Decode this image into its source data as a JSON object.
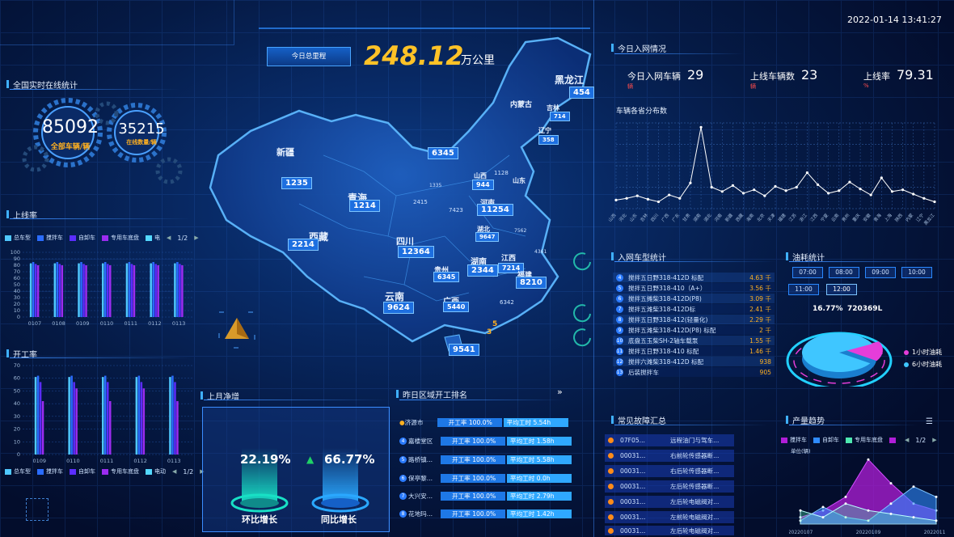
{
  "header": {
    "datetime": "2022-01-14 13:41:27",
    "mileage_button": "今日总里程",
    "mileage_value": "248.12",
    "mileage_unit": "万公里"
  },
  "online": {
    "title": "全国实时在线统计",
    "total_value": "85092",
    "total_label": "全部车辆/辆",
    "online_value": "35215",
    "online_label": "在线数量/辆"
  },
  "online_rate": {
    "title": "上线率",
    "legend": [
      "总车型",
      "搅拌车",
      "自卸车",
      "专用车底盘",
      "电"
    ],
    "page": "1/2",
    "colors": [
      "#4fc8ff",
      "#2a6cff",
      "#5b2dff",
      "#9b2cf0",
      "#54d8ff"
    ]
  },
  "work_rate": {
    "title": "开工率",
    "legend": [
      "总车型",
      "搅拌车",
      "自卸车",
      "专用车底盘",
      "电动"
    ],
    "page": "1/2"
  },
  "chart_data": [
    {
      "type": "bar",
      "title": "上线率",
      "categories": [
        "0107",
        "0108",
        "0109",
        "0110",
        "0111",
        "0112",
        "0113"
      ],
      "ylim": [
        0,
        100
      ],
      "yticks": [
        0,
        10,
        20,
        30,
        40,
        50,
        60,
        70,
        80,
        90,
        100
      ],
      "series": [
        {
          "name": "总车型",
          "values": [
            83,
            83,
            83,
            83,
            83,
            83,
            83
          ]
        },
        {
          "name": "搅拌车",
          "values": [
            85,
            85,
            85,
            85,
            85,
            85,
            85
          ]
        },
        {
          "name": "自卸车",
          "values": [
            82,
            82,
            82,
            82,
            82,
            82,
            82
          ]
        },
        {
          "name": "专用车底盘",
          "values": [
            80,
            80,
            80,
            80,
            80,
            80,
            80
          ]
        }
      ]
    },
    {
      "type": "bar",
      "title": "开工率",
      "categories": [
        "0109",
        "0110",
        "0111",
        "0112",
        "0113"
      ],
      "ylim": [
        0,
        70
      ],
      "yticks": [
        0,
        10,
        20,
        30,
        40,
        50,
        60,
        70
      ],
      "series": [
        {
          "name": "总车型",
          "values": [
            61,
            61,
            61,
            61,
            61
          ]
        },
        {
          "name": "搅拌车",
          "values": [
            62,
            62,
            62,
            62,
            62
          ]
        },
        {
          "name": "自卸车",
          "values": [
            57,
            57,
            57,
            57,
            57
          ]
        },
        {
          "name": "专用车底盘",
          "values": [
            42,
            52,
            42,
            52,
            42
          ]
        }
      ]
    },
    {
      "type": "line",
      "title": "车辆各省分布数",
      "x": [
        "山西",
        "河北",
        "山东",
        "吉林",
        "四川",
        "广西",
        "广东",
        "甘肃",
        "湖南",
        "湖北",
        "河南",
        "新疆",
        "西藏",
        "海南",
        "北京",
        "天津",
        "福建",
        "江苏",
        "浙江",
        "江西",
        "宁夏",
        "云南",
        "贵州",
        "重庆",
        "安徽",
        "青海",
        "上海",
        "陕西",
        "内蒙",
        "辽宁",
        "黑龙江"
      ],
      "values": [
        1000,
        1200,
        1500,
        1100,
        800,
        1600,
        1200,
        3000,
        9500,
        2500,
        2000,
        2700,
        1800,
        2200,
        1500,
        2600,
        2100,
        2500,
        4200,
        2800,
        1800,
        2100,
        3100,
        2300,
        1600,
        3600,
        2000,
        2200,
        1700,
        1200,
        800
      ],
      "ylim": [
        0,
        10000
      ]
    },
    {
      "type": "pie",
      "title": "油耗统计",
      "labels": [
        "1小时油耗",
        "6小时油耗"
      ],
      "values": [
        16.77,
        83.23
      ]
    },
    {
      "type": "area",
      "title": "产量趋势",
      "x": [
        "20220107",
        "20220109",
        "20220111"
      ],
      "ylabel": "单位(辆)",
      "series": [
        {
          "name": "搅拌车",
          "values": [
            10,
            20,
            40,
            95,
            60,
            30,
            20
          ]
        },
        {
          "name": "自卸车",
          "values": [
            5,
            25,
            10,
            5,
            30,
            55,
            40
          ]
        },
        {
          "name": "专用车底盘",
          "values": [
            20,
            10,
            30,
            20,
            15,
            10,
            5
          ]
        }
      ]
    }
  ],
  "map": {
    "provinces": [
      {
        "n": "黑龙江",
        "v": "454"
      },
      {
        "n": "吉林",
        "v": "714"
      },
      {
        "n": "辽宁",
        "v": "358"
      },
      {
        "n": "新疆",
        "v": "1235"
      },
      {
        "n": "青海",
        "v": "1214"
      },
      {
        "n": "西藏",
        "v": "2214"
      },
      {
        "n": "四川",
        "v": "12364"
      },
      {
        "n": "云南",
        "v": "9624"
      },
      {
        "n": "广西",
        "v": "5440"
      },
      {
        "n": "河南",
        "v": "11254"
      },
      {
        "n": "湖南",
        "v": "2344"
      },
      {
        "n": "江西",
        "v": "7214"
      },
      {
        "n": "福建",
        "v": "8210"
      },
      {
        "n": "贵州",
        "v": "6345"
      },
      {
        "n": "湖北",
        "v": "9647"
      },
      {
        "n": "山西",
        "v": "944"
      },
      {
        "n": "山东",
        "v": "2"
      },
      {
        "n": "内蒙古",
        "v": "6345"
      },
      {
        "n": "海南",
        "v": "9541"
      }
    ],
    "small_labels": [
      "内",
      "蒙",
      "古",
      "甘",
      "肃",
      "宁夏",
      "陕",
      "西",
      "重",
      "庆",
      "安徽",
      "浙江",
      "广东",
      "台湾",
      "河北",
      "北京",
      "天津"
    ],
    "small_values": [
      "2415",
      "7423",
      "1128",
      "1335",
      "4361",
      "7562",
      "6342",
      "5",
      "3"
    ]
  },
  "entries": {
    "title": "今日入网情况",
    "in_label": "今日入网车辆",
    "in_value": "29",
    "in_unit": "辆",
    "online_label": "上线车辆数",
    "online_value": "23",
    "online_unit": "辆",
    "rate_label": "上线率",
    "rate_value": "79.31",
    "rate_unit": "%"
  },
  "dist_title": "车辆各省分布数",
  "models": {
    "title": "入网车型统计",
    "rows": [
      {
        "i": "4",
        "n": "搅拌五日野318-412D 标配",
        "v": "4.63 千"
      },
      {
        "i": "5",
        "n": "搅拌五日野318-410（A+）",
        "v": "3.56 千"
      },
      {
        "i": "6",
        "n": "搅拌五摊柴318-412D(P8)",
        "v": "3.09 千"
      },
      {
        "i": "7",
        "n": "搅拌五潍柴318-412D标",
        "v": "2.41 千"
      },
      {
        "i": "8",
        "n": "搅拌五日野318-412(轻量化)",
        "v": "2.29 千"
      },
      {
        "i": "9",
        "n": "搅拌五潍柴318-412D(P8) 标配",
        "v": "2 千"
      },
      {
        "i": "10",
        "n": "底盘五玉柴SH-2轴车载泵",
        "v": "1.55 千"
      },
      {
        "i": "11",
        "n": "搅拌五日野318-410 标配",
        "v": "1.46 千"
      },
      {
        "i": "12",
        "n": "搅拌六潍柴318-412D 标配",
        "v": "938"
      },
      {
        "i": "13",
        "n": "后装搅拌车",
        "v": "905"
      }
    ]
  },
  "fuel": {
    "title": "油耗统计",
    "times": [
      "07:00",
      "08:00",
      "09:00",
      "10:00",
      "11:00",
      "12:00"
    ],
    "pct": "16.77%",
    "value": "720369L",
    "legend": [
      "1小时油耗",
      "6小时油耗"
    ]
  },
  "growth": {
    "title": "上月净增",
    "mom_value": "22.19%",
    "mom_label": "环比增长",
    "yoy_value": "66.77%",
    "yoy_label": "同比增长"
  },
  "ranking": {
    "title": "昨日区域开工排名",
    "rows": [
      {
        "i": "",
        "n": "济源市",
        "a": "开工率",
        "p": "100.0%",
        "b": "平均工时",
        "h": "5.54h"
      },
      {
        "i": "4",
        "n": "嘉楼堂区",
        "a": "开工率",
        "p": "100.0%",
        "b": "平均工时",
        "h": "1.58h"
      },
      {
        "i": "5",
        "n": "路桥镇...",
        "a": "开工率",
        "p": "100.0%",
        "b": "平均工时",
        "h": "5.58h"
      },
      {
        "i": "6",
        "n": "保亭黎...",
        "a": "开工率",
        "p": "100.0%",
        "b": "平均工时",
        "h": "0.0h"
      },
      {
        "i": "7",
        "n": "大兴安...",
        "a": "开工率",
        "p": "100.0%",
        "b": "平均工时",
        "h": "2.79h"
      },
      {
        "i": "8",
        "n": "花地玛...",
        "a": "开工率",
        "p": "100.0%",
        "b": "平均工时",
        "h": "1.42h"
      }
    ]
  },
  "faults": {
    "title": "常见故障汇总",
    "rows": [
      {
        "id": "07F05...",
        "d": "远程油门与驾车..."
      },
      {
        "id": "00031...",
        "d": "右前轮传感器断..."
      },
      {
        "id": "00031...",
        "d": "右后轮传感器断..."
      },
      {
        "id": "00031...",
        "d": "左后轮传感器断..."
      },
      {
        "id": "00031...",
        "d": "左后轮电磁阀对..."
      },
      {
        "id": "00031...",
        "d": "左前轮电磁阀对..."
      },
      {
        "id": "00031...",
        "d": "左后轮电磁阀对..."
      }
    ]
  },
  "trend": {
    "title": "产量趋势",
    "legend": [
      "搅拌车",
      "自卸车",
      "专用车底盘"
    ],
    "page": "1/2",
    "unit": "单位(辆)",
    "xlabels": [
      "20220107",
      "20220109",
      "20220111"
    ]
  }
}
